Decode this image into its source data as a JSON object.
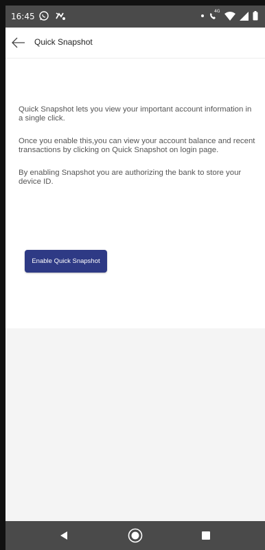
{
  "status_bar": {
    "time": "16:45",
    "icons": [
      "whatsapp-icon",
      "notification-icon",
      "dot-icon",
      "wifi-call-icon",
      "wifi-icon",
      "signal-icon",
      "battery-icon"
    ],
    "network_label": "4G"
  },
  "app_bar": {
    "title": "Quick Snapshot",
    "back_icon": "arrow-left-icon"
  },
  "content": {
    "paragraph_1_line_1": "Quick Snapshot lets you view your important account information in",
    "paragraph_1_line_2": "a single click.",
    "paragraph_2_line_1": "Once you enable this,you can view your account balance and recent",
    "paragraph_2_line_2": "transactions by clicking on Quick Snapshot on login page.",
    "paragraph_3_line_1": "By enabling Snapshot you are authorizing the bank to store your",
    "paragraph_3_line_2": "device ID.",
    "enable_button_label": "Enable Quick Snapshot"
  },
  "nav_bar": {
    "icons": [
      "back-triangle-icon",
      "home-circle-icon",
      "recent-square-icon"
    ]
  },
  "colors": {
    "status_bar_bg": "#4a4a4a",
    "button_bg": "#2e3a85",
    "text": "#555555",
    "lower_area_bg": "#f4f4f4"
  }
}
